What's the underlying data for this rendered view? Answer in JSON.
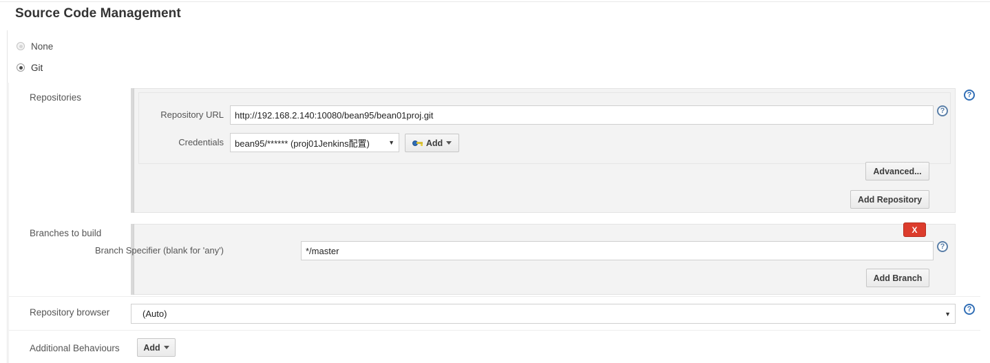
{
  "page": {
    "title": "Source Code Management"
  },
  "scm_options": [
    {
      "label": "None",
      "selected": false
    },
    {
      "label": "Git",
      "selected": true
    }
  ],
  "rows": {
    "repositories_label": "Repositories",
    "branches_label": "Branches to build",
    "repository_browser_label": "Repository browser",
    "additional_behaviours_label": "Additional Behaviours"
  },
  "repository": {
    "url_label": "Repository URL",
    "url_value": "http://192.168.2.140:10080/bean95/bean01proj.git",
    "credentials_label": "Credentials",
    "credentials_value": "bean95/****** (proj01Jenkins配置)",
    "credentials_add_label": "Add",
    "advanced_label": "Advanced...",
    "add_repository_label": "Add Repository"
  },
  "branches": {
    "specifier_label": "Branch Specifier (blank for 'any')",
    "specifier_value": "*/master",
    "add_branch_label": "Add Branch",
    "delete_label": "X"
  },
  "repository_browser": {
    "value": "(Auto)"
  },
  "additional_behaviours": {
    "add_label": "Add"
  },
  "icons": {
    "help": "?",
    "dropdown_arrow": "▼"
  },
  "colors": {
    "panel_background": "#f3f3f3",
    "delete_button": "#dc3c2c",
    "help_icon": "#2f6db5",
    "key_icon_bow": "#2f6db5",
    "key_icon_shaft": "#e8d24a"
  }
}
